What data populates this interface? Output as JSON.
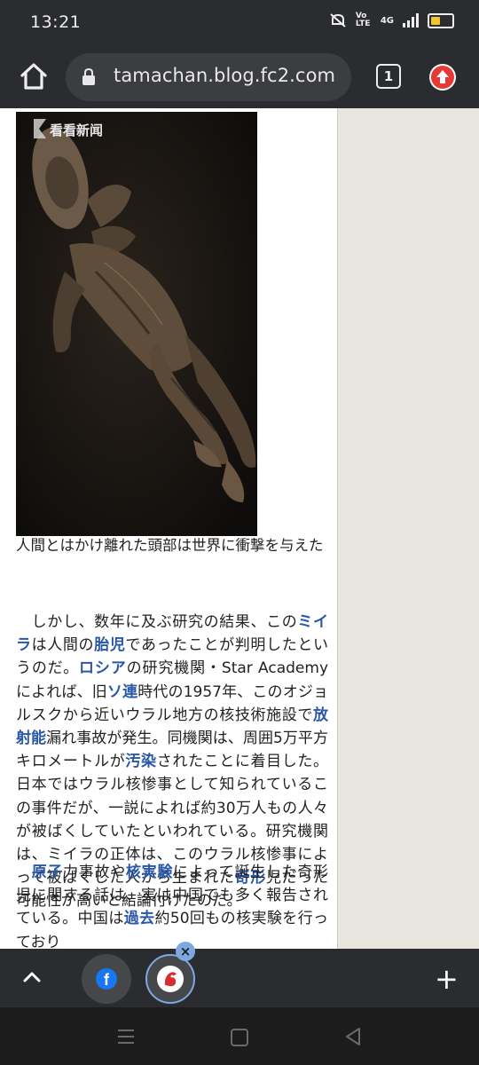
{
  "status": {
    "time": "13:21",
    "volte_label": "Vo LTE",
    "network_label": "4G"
  },
  "toolbar": {
    "url": "tamachan.blog.fc2.com",
    "tab_count": "1"
  },
  "article": {
    "image_watermark": "看看新闻",
    "caption": "人間とはかけ離れた頭部は世界に衝撃を与えた",
    "para1": {
      "t1": "　しかし、数年に及ぶ研究の結果、この",
      "l1": "ミイラ",
      "t2": "は人間の",
      "l2": "胎児",
      "t3": "であったことが判明したというのだ。",
      "l3": "ロシア",
      "t4": "の研究機関・Star Academyによれば、旧",
      "l4": "ソ連",
      "t5": "時代の1957年、このオジョルスクから近いウラル地方の核技術施設で",
      "l5": "放射能",
      "t6": "漏れ事故が発生。同機関は、周囲5万平方キロメートルが",
      "l6": "汚染",
      "t7": "されたことに着目した。日本ではウラル核惨事として知られているこの事件だが、一説によれば約30万人もの人々が被ばくしていたといわれている。研究機関は、ミイラの正体は、このウラル核惨事によって被ばくした人から生まれた",
      "l7": "奇形",
      "t8": "児だった可能性が高いと結論付けたのだ。"
    },
    "para2": {
      "t0": "　",
      "l1": "原子",
      "t1": "力事故や",
      "l2": "核実験",
      "t2": "によって誕生した奇形児に関する話は、実は中国でも多く報告されている。中国は",
      "l3": "過去",
      "t3": "約50回もの核実験を行っており"
    }
  },
  "bottom": {
    "facebook_letter": "f",
    "plus_label": "+",
    "close_label": "×"
  },
  "icons": {
    "home": "home-icon",
    "lock": "lock-icon",
    "tabs": "tab-switcher-icon",
    "update": "update-arrow-icon",
    "up": "chevron-up-icon",
    "facebook": "facebook-icon",
    "site": "site-favicon-icon",
    "plus": "plus-icon",
    "close": "close-icon"
  },
  "colors": {
    "link": "#2a58a8",
    "chrome_bar": "#2b2c2f",
    "update_red": "#e53935",
    "bubble_accent": "#7fa8e0"
  }
}
